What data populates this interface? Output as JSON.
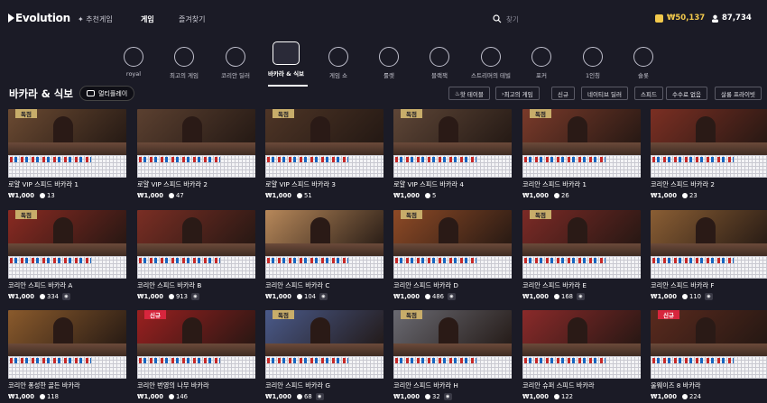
{
  "header": {
    "logo": "Evolution",
    "nav": [
      {
        "label": "추천게임"
      },
      {
        "label": "게임"
      },
      {
        "label": "즐겨찾기"
      }
    ],
    "search_placeholder": "찾기",
    "balance": "₩50,137",
    "online_count": "87,734"
  },
  "categories": [
    {
      "label": "royal"
    },
    {
      "label": "최고의 게임"
    },
    {
      "label": "코리안 딜러"
    },
    {
      "label": "바카라 & 식보"
    },
    {
      "label": "게임 쇼"
    },
    {
      "label": "룰렛"
    },
    {
      "label": "블랙잭"
    },
    {
      "label": "스트리머의 테빌"
    },
    {
      "label": "포커"
    },
    {
      "label": "1인칭"
    },
    {
      "label": "슬롯"
    }
  ],
  "section": {
    "title": "바카라 & 식보",
    "multiplay_label": "멀티플레이",
    "filters": [
      {
        "label": "핫 테이블"
      },
      {
        "label": "최고의 게임"
      },
      {
        "label": "신규"
      },
      {
        "label": "네이티브 딜러"
      },
      {
        "label": "스피드"
      },
      {
        "label": "수수료 없음"
      },
      {
        "label": "살롱 프라이빗"
      }
    ]
  },
  "tiles": [
    {
      "name": "로얄 VIP 스피드 바카라 1",
      "bet": "₩1,000",
      "players": "13",
      "badge": "독점",
      "theme": "#6b4a32"
    },
    {
      "name": "로얄 VIP 스피드 바카라 2",
      "bet": "₩1,000",
      "players": "47",
      "badge": "",
      "theme": "#5b4030"
    },
    {
      "name": "로얄 VIP 스피드 바카라 3",
      "bet": "₩1,000",
      "players": "51",
      "badge": "독점",
      "theme": "#4e3526"
    },
    {
      "name": "로얄 VIP 스피드 바카라 4",
      "bet": "₩1,000",
      "players": "5",
      "badge": "독점",
      "theme": "#5e4637"
    },
    {
      "name": "코리안 스피드 바카라 1",
      "bet": "₩1,000",
      "players": "26",
      "badge": "독점",
      "theme": "#7a3a2a"
    },
    {
      "name": "코리안 스피드 바카라 2",
      "bet": "₩1,000",
      "players": "23",
      "badge": "",
      "theme": "#7b2f23"
    },
    {
      "name": "코리안 스피드 바카라 A",
      "bet": "₩1,000",
      "players": "334",
      "badge": "독점",
      "theme": "#8a2a22",
      "tag": true
    },
    {
      "name": "코리안 스피드 바카라 B",
      "bet": "₩1,000",
      "players": "913",
      "badge": "",
      "theme": "#7a2e24",
      "tag": true
    },
    {
      "name": "코리안 스피드 바카라 C",
      "bet": "₩1,000",
      "players": "104",
      "badge": "",
      "theme": "#b7885a",
      "tag": true
    },
    {
      "name": "코리안 스피드 바카라 D",
      "bet": "₩1,000",
      "players": "486",
      "badge": "독점",
      "theme": "#8e4a26",
      "tag": true
    },
    {
      "name": "코리안 스피드 바카라 E",
      "bet": "₩1,000",
      "players": "168",
      "badge": "독점",
      "theme": "#7c2a26",
      "tag": true
    },
    {
      "name": "코리안 스피드 바카라 F",
      "bet": "₩1,000",
      "players": "110",
      "badge": "",
      "theme": "#8a5e34",
      "tag": true
    },
    {
      "name": "코리안 퐁성한 골든 바카라",
      "bet": "₩1,000",
      "players": "118",
      "badge": "",
      "theme": "#8a5a2c"
    },
    {
      "name": "코리안 번영의 나무 바카라",
      "bet": "₩1,000",
      "players": "146",
      "badge": "신규",
      "theme": "#9a2020"
    },
    {
      "name": "코리안 스피드 바카라 G",
      "bet": "₩1,000",
      "players": "68",
      "badge": "독점",
      "theme": "#4a5a8a",
      "tag": true
    },
    {
      "name": "코리안 스피드 바카라 H",
      "bet": "₩1,000",
      "players": "32",
      "badge": "독점",
      "theme": "#6a6a72",
      "tag": true
    },
    {
      "name": "코리안 슈퍼 스피드 바카라",
      "bet": "₩1,000",
      "players": "122",
      "badge": "",
      "theme": "#8a2a2a"
    },
    {
      "name": "울웨이즈 8 바카라",
      "bet": "₩1,000",
      "players": "224",
      "badge": "신규",
      "theme": "#5a2a1e"
    }
  ]
}
